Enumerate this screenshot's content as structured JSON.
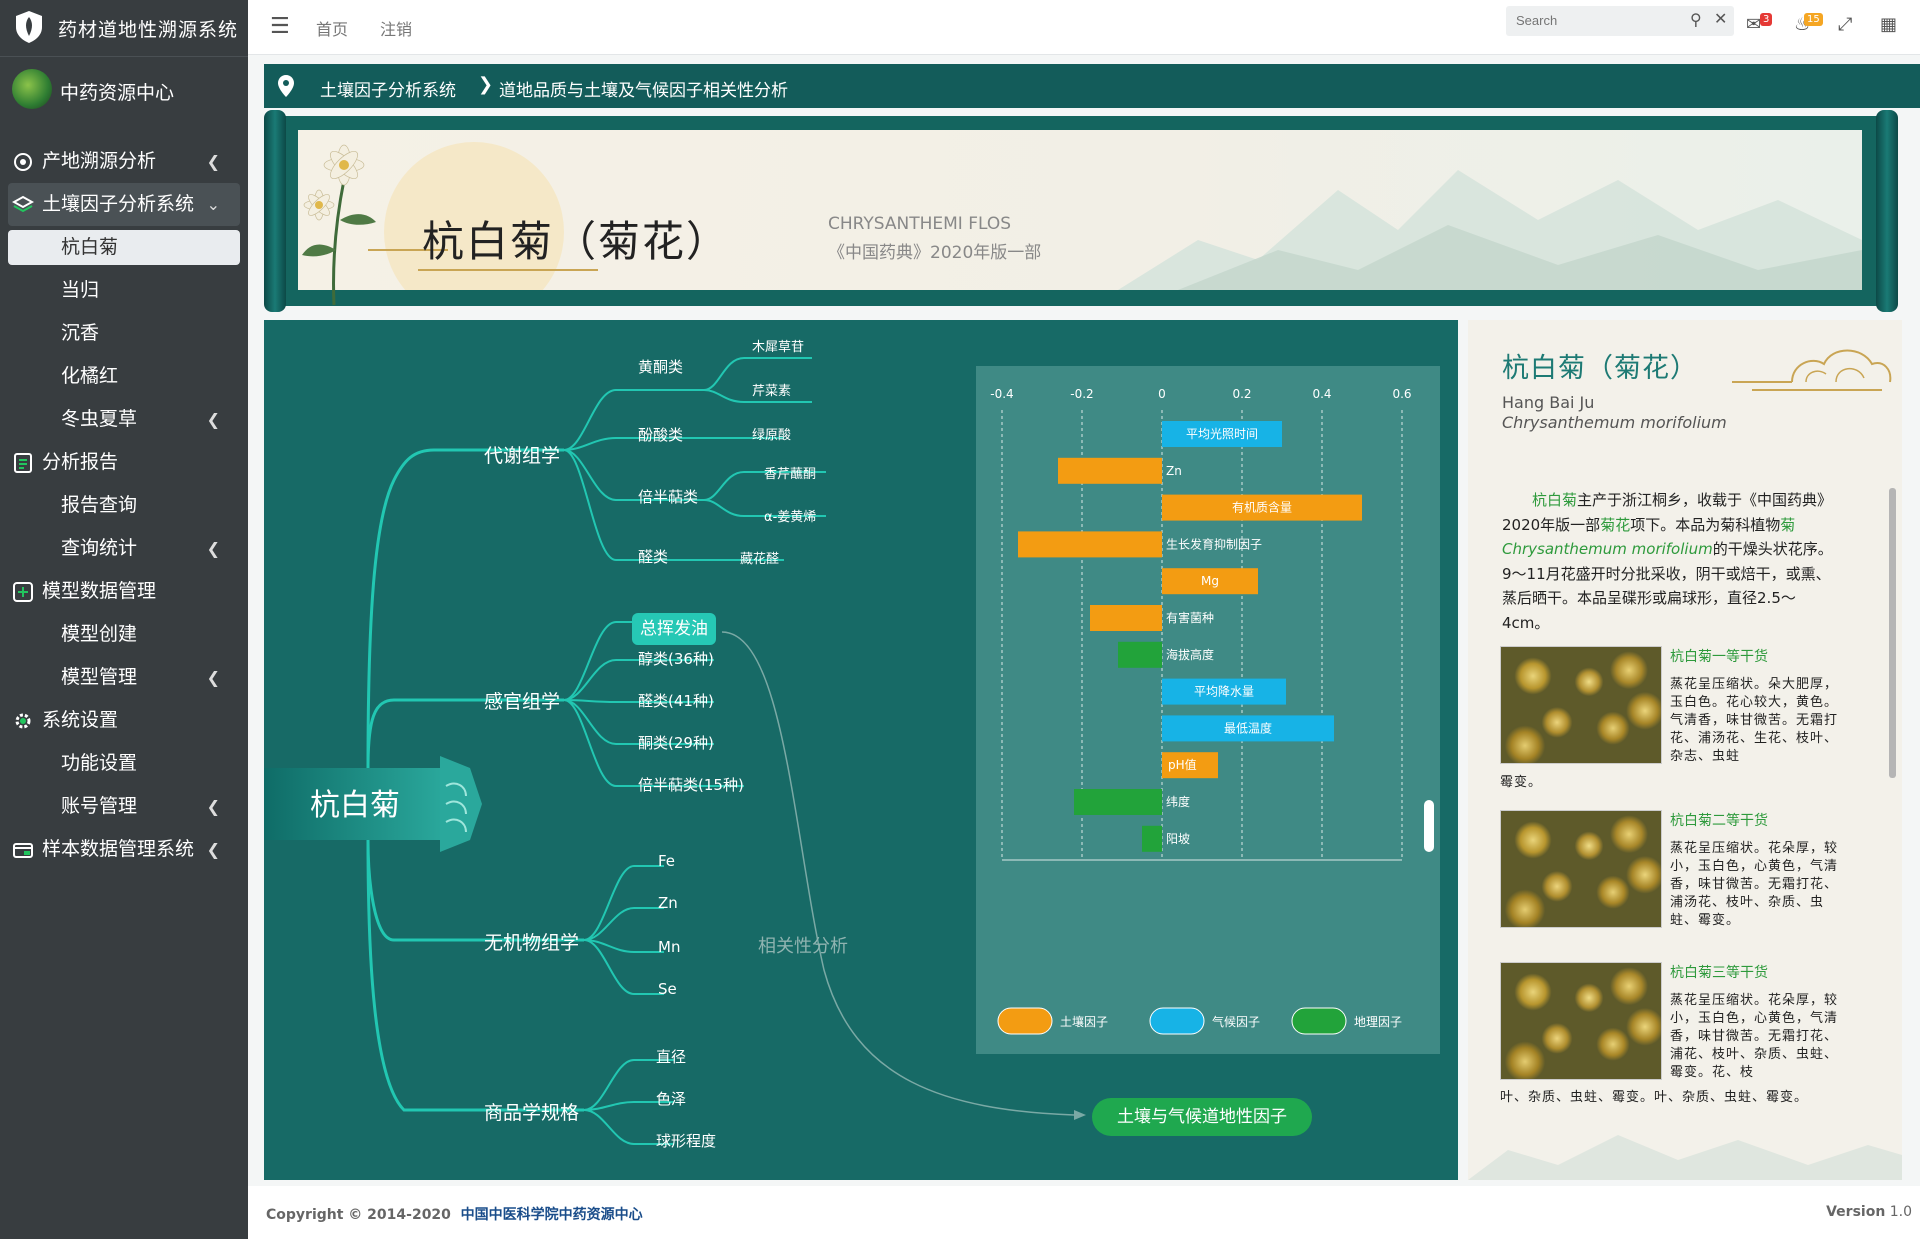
{
  "app": {
    "title": "药材道地性溯源系统",
    "org": "中药资源中心"
  },
  "sidebar": {
    "items": [
      {
        "label": "产地溯源分析",
        "icon": "target-icon"
      },
      {
        "label": "土壤因子分析系统",
        "icon": "layers-icon"
      },
      {
        "label": "杭白菊"
      },
      {
        "label": "当归"
      },
      {
        "label": "沉香"
      },
      {
        "label": "化橘红"
      },
      {
        "label": "冬虫夏草"
      },
      {
        "label": "分析报告",
        "icon": "report-icon"
      },
      {
        "label": "报告查询"
      },
      {
        "label": "查询统计"
      },
      {
        "label": "模型数据管理",
        "icon": "plus-box-icon"
      },
      {
        "label": "模型创建"
      },
      {
        "label": "模型管理"
      },
      {
        "label": "系统设置",
        "icon": "gear-icon"
      },
      {
        "label": "功能设置"
      },
      {
        "label": "账号管理"
      },
      {
        "label": "样本数据管理系统",
        "icon": "database-icon"
      }
    ]
  },
  "topbar": {
    "home": "首页",
    "logout": "注销",
    "search_placeholder": "Search",
    "messages_count": "3",
    "notifications_count": "15"
  },
  "breadcrumb": {
    "level1": "土壤因子分析系统",
    "level2": "道地品质与土壤及气候因子相关性分析"
  },
  "banner": {
    "title": "杭白菊（菊花）",
    "latin": "CHRYSANTHEMI FLOS",
    "pharmacopoeia": "《中国药典》2020年版一部"
  },
  "mindmap": {
    "root": "杭白菊",
    "branches": {
      "metabolic": "代谢组学",
      "sensory": "感官组学",
      "inorganic": "无机物组学",
      "commodity": "商品学规格"
    },
    "metabolic": {
      "flavonoids": "黄酮类",
      "lignan": "木犀草苷",
      "apigenin": "芹菜素",
      "phenolic_acids": "酚酸类",
      "chlorogenic": "绿原酸",
      "sesquiterpenes": "倍半萜类",
      "vanillin": "香芹蘸酮",
      "curcumene": "α-姜黄烯",
      "aldehydes": "醛类",
      "saffranal": "藏花醛"
    },
    "sensory": {
      "volatile_oil": "总挥发油",
      "alcohols": "醇类(36种)",
      "aldehydes": "醛类(41种)",
      "ketones": "酮类(29种)",
      "sesquiterpenes": "倍半萜类(15种)"
    },
    "inorganic": {
      "fe": "Fe",
      "zn": "Zn",
      "mn": "Mn",
      "se": "Se"
    },
    "commodity": {
      "diameter": "直径",
      "color": "色泽",
      "sphericity": "球形程度"
    },
    "correlation_label": "相关性分析",
    "result_button": "土壤与气候道地性因子"
  },
  "chart_data": {
    "type": "bar",
    "orientation": "horizontal",
    "categories": [
      "平均光照时间",
      "Zn",
      "有机质含量",
      "生长发育抑制因子",
      "Mg",
      "有害菌种",
      "海拔高度",
      "平均降水量",
      "最低温度",
      "pH值",
      "纬度",
      "阳坡"
    ],
    "values": [
      0.3,
      -0.26,
      0.5,
      -0.36,
      0.24,
      -0.18,
      -0.11,
      0.31,
      0.43,
      0.14,
      -0.22,
      -0.05
    ],
    "series_type": [
      "气候因子",
      "土壤因子",
      "土壤因子",
      "土壤因子",
      "土壤因子",
      "土壤因子",
      "地理因子",
      "气候因子",
      "气候因子",
      "土壤因子",
      "地理因子",
      "地理因子"
    ],
    "legend": [
      {
        "name": "土壤因子",
        "color": "#f39c12"
      },
      {
        "name": "气候因子",
        "color": "#17b3e6"
      },
      {
        "name": "地理因子",
        "color": "#22a33a"
      }
    ],
    "xticks": [
      "-0.4",
      "-0.2",
      "0",
      "0.2",
      "0.4",
      "0.6"
    ],
    "xlim": [
      -0.4,
      0.6
    ],
    "legend_position": "bottom",
    "grid": "vertical dashed"
  },
  "info": {
    "title": "杭白菊（菊花）",
    "pinyin": "Hang Bai Ju",
    "latin": "Chrysanthemum morifolium",
    "desc": {
      "name": "杭白菊",
      "p1": "主产于浙江桐乡，收载于《中国药典》2020年版一部",
      "link": "菊花",
      "p2": "项下。本品为菊科植物",
      "species_cn": "菊",
      "species_latin": "Chrysanthemum morifolium",
      "p3": "的干燥头状花序。9～11月花盛开时分批采收，阴干或焙干，或熏、蒸后晒干。本品呈碟形或扁球形，直径2.5～4cm。"
    },
    "grades": [
      {
        "title": "杭白菊一等干货",
        "text": "蒸花呈压缩状。朵大肥厚，玉白色。花心较大，黄色。气清香，味甘微苦。无霜打花、浦汤花、生花、枝叶、杂志、虫蛀",
        "tail": "霉变。"
      },
      {
        "title": "杭白菊二等干货",
        "text": "蒸花呈压缩状。花朵厚，较小，玉白色，心黄色，气清香，味甘微苦。无霜打花、浦汤花、枝叶、杂质、虫蛀、霉变。",
        "tail": ""
      },
      {
        "title": "杭白菊三等干货",
        "text": "蒸花呈压缩状。花朵厚，较小，玉白色，心黄色，气清香，味甘微苦。无霜打花、浦花、枝叶、杂质、虫蛀、霉变。花、枝",
        "tail": "叶、杂质、虫蛀、霉变。叶、杂质、虫蛀、霉变。"
      }
    ]
  },
  "footer": {
    "copyright": "Copyright © 2014-2020",
    "org": "中国中医科学院中药资源中心",
    "version_label": "Version",
    "version": "1.0"
  }
}
